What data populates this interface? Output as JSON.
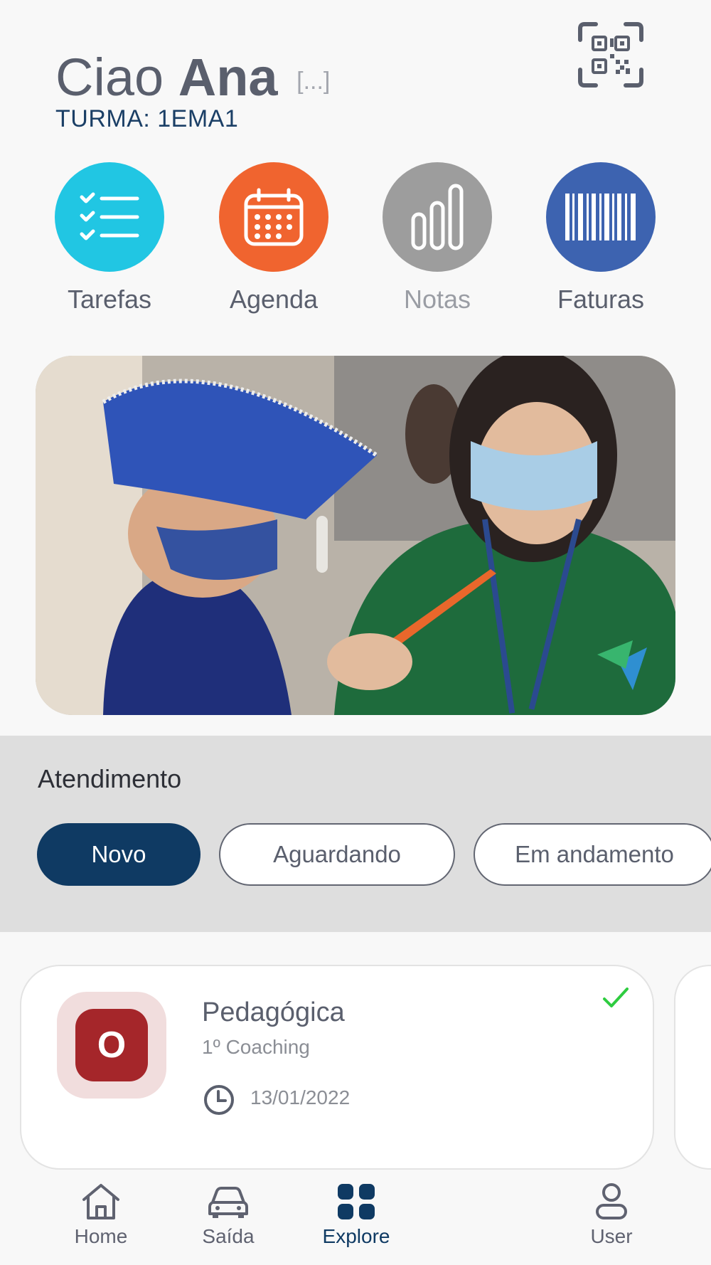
{
  "header": {
    "greeting_prefix": "Ciao",
    "user_name": "Ana",
    "more": "[...]",
    "class_label": "TURMA: 1EMA1"
  },
  "quick_actions": [
    {
      "label": "Tarefas",
      "icon": "checklist-icon",
      "color": "#21c6e3"
    },
    {
      "label": "Agenda",
      "icon": "calendar-icon",
      "color": "#f0642f"
    },
    {
      "label": "Notas",
      "icon": "bar-chart-icon",
      "color": "#9d9d9d"
    },
    {
      "label": "Faturas",
      "icon": "barcode-icon",
      "color": "#3d63b0"
    }
  ],
  "atendimento": {
    "title": "Atendimento",
    "filters": [
      "Novo",
      "Aguardando",
      "Em andamento"
    ],
    "active_filter": "Novo"
  },
  "card": {
    "initial": "O",
    "title": "Pedagógica",
    "subtitle": "1º Coaching",
    "date": "13/01/2022",
    "status_icon": "check-icon"
  },
  "nav": {
    "items": [
      {
        "label": "Home",
        "icon": "home-icon"
      },
      {
        "label": "Saída",
        "icon": "car-icon"
      },
      {
        "label": "Explore",
        "icon": "grid-icon"
      },
      {
        "label": "User",
        "icon": "user-icon"
      }
    ],
    "active": "Explore"
  },
  "colors": {
    "primary": "#0f3a63",
    "check": "#2ecc40",
    "avatar": "#a5262a"
  }
}
